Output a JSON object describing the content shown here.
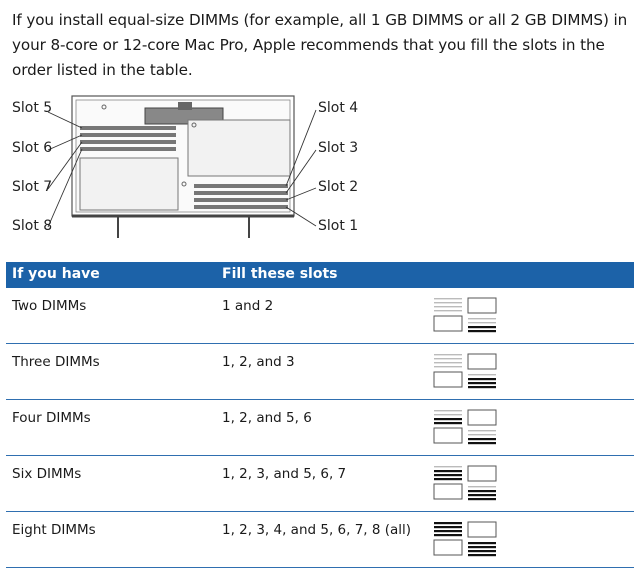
{
  "intro": "If you install equal-size DIMMs (for example, all 1 GB DIMMS or all 2 GB DIMMS) in your 8-core or 12-core Mac Pro, Apple recommends that you fill the slots in the order listed in the table.",
  "slots": {
    "slot5": "Slot 5",
    "slot6": "Slot 6",
    "slot7": "Slot 7",
    "slot8": "Slot 8",
    "slot4": "Slot 4",
    "slot3": "Slot 3",
    "slot2": "Slot 2",
    "slot1": "Slot 1"
  },
  "table": {
    "headers": [
      "If you have",
      "Fill these slots"
    ],
    "rows": [
      {
        "have": "Two DIMMs",
        "fill": "1 and 2",
        "upper_filled": 0,
        "lower_filled": 2
      },
      {
        "have": "Three DIMMs",
        "fill": "1, 2, and 3",
        "upper_filled": 0,
        "lower_filled": 3
      },
      {
        "have": "Four DIMMs",
        "fill": "1, 2, and 5, 6",
        "upper_filled": 2,
        "lower_filled": 2
      },
      {
        "have": "Six DIMMs",
        "fill": "1, 2, 3, and 5, 6, 7",
        "upper_filled": 3,
        "lower_filled": 3
      },
      {
        "have": "Eight DIMMs",
        "fill": "1, 2, 3, 4, and 5, 6, 7, 8 (all)",
        "upper_filled": 4,
        "lower_filled": 4
      }
    ]
  },
  "colors": {
    "header_bg": "#1c62a8",
    "row_rule": "#2f6fb0",
    "filled_slot": "#111111",
    "empty_slot": "#bbbbbb"
  }
}
